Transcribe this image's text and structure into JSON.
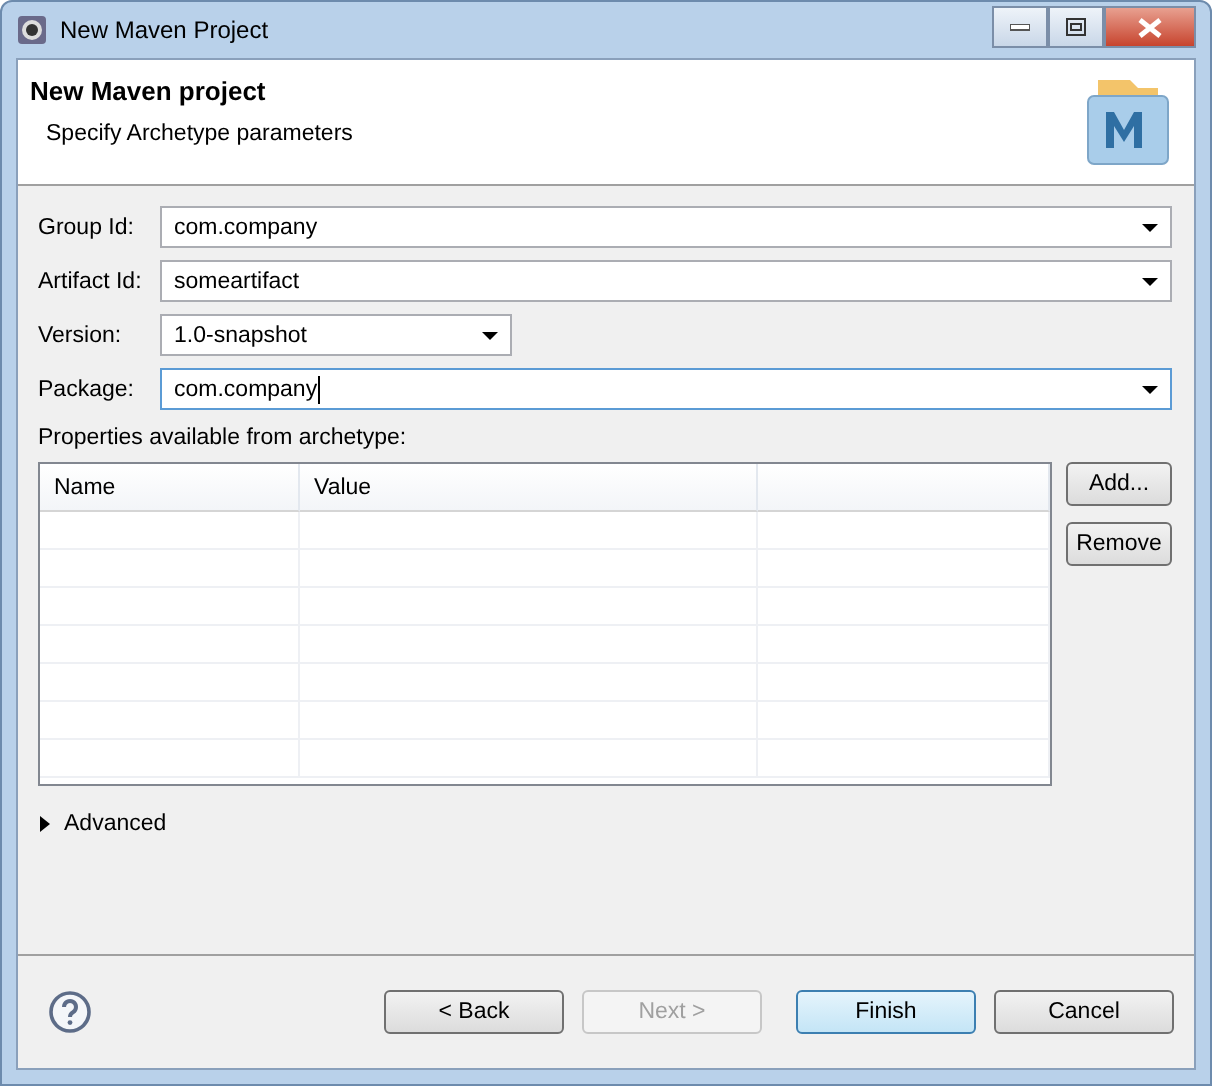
{
  "window": {
    "title": "New Maven Project"
  },
  "header": {
    "title": "New Maven project",
    "subtitle": "Specify Archetype parameters"
  },
  "fields": [
    {
      "label": "Group Id:",
      "value": "com.company",
      "wide": true,
      "focused": false
    },
    {
      "label": "Artifact Id:",
      "value": "someartifact",
      "wide": true,
      "focused": false
    },
    {
      "label": "Version:",
      "value": "1.0-snapshot",
      "wide": false,
      "focused": false
    },
    {
      "label": "Package:",
      "value": "com.company",
      "wide": true,
      "focused": true
    }
  ],
  "properties": {
    "label": "Properties available from archetype:",
    "columns": [
      "Name",
      "Value"
    ],
    "buttons": [
      {
        "label": "Add..."
      },
      {
        "label": "Remove"
      }
    ]
  },
  "advanced": {
    "label": "Advanced",
    "expanded": false
  },
  "buttons": [
    {
      "label": "< Back",
      "disabled": false,
      "default": false
    },
    {
      "label": "Next >",
      "disabled": true,
      "default": false
    },
    {
      "label": "Finish",
      "disabled": false,
      "default": true
    },
    {
      "label": "Cancel",
      "disabled": false,
      "default": false
    }
  ]
}
